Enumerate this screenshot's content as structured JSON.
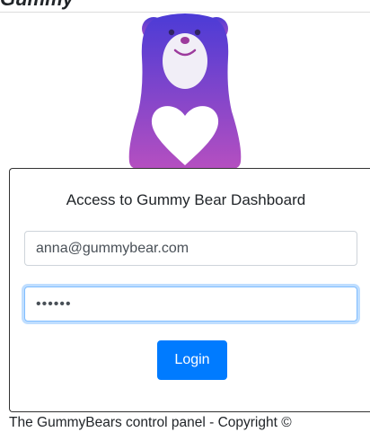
{
  "header": {
    "title": "Gummy"
  },
  "login": {
    "title": "Access to Gummy Bear Dashboard",
    "email_value": "anna@gummybear.com",
    "password_value": "secret",
    "login_label": "Login"
  },
  "footer": {
    "text": "The GummyBears control panel - Copyright ©"
  },
  "colors": {
    "primary": "#007bff",
    "logo_top": "#4b3bd6",
    "logo_bottom": "#b54fc0"
  }
}
